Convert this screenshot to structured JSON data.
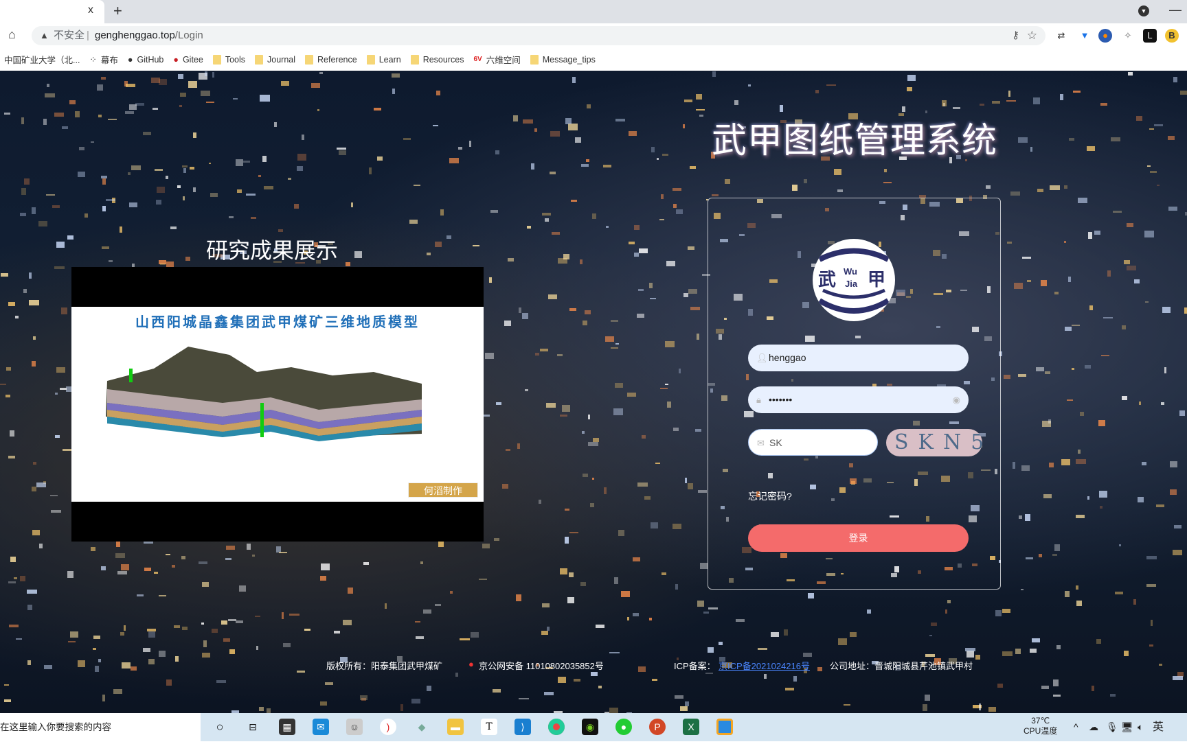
{
  "browser": {
    "tab_close": "x",
    "new_tab": "+",
    "security": "不安全",
    "url_host": "genghenggao.top",
    "url_path": "/Login",
    "bookmarks": [
      {
        "label": "中国矿业大学（北...",
        "icon": "cumt-icon"
      },
      {
        "label": "幕布",
        "icon": "mubu-icon"
      },
      {
        "label": "GitHub",
        "icon": "github-icon"
      },
      {
        "label": "Gitee",
        "icon": "gitee-icon"
      },
      {
        "label": "Tools",
        "icon": "folder-icon"
      },
      {
        "label": "Journal",
        "icon": "folder-icon"
      },
      {
        "label": "Reference",
        "icon": "folder-icon"
      },
      {
        "label": "Learn",
        "icon": "folder-icon"
      },
      {
        "label": "Resources",
        "icon": "folder-icon"
      },
      {
        "label": "六维空间",
        "icon": "6v-icon"
      },
      {
        "label": "Message_tips",
        "icon": "folder-icon"
      }
    ],
    "extensions": [
      "translate-icon",
      "vpn-icon",
      "firefox-like-icon",
      "satellite-icon",
      "l-icon",
      "b-icon"
    ]
  },
  "login": {
    "title": "武甲图纸管理系统",
    "logo_text": [
      "武",
      "Wu",
      "Jia",
      "甲"
    ],
    "username": "henggao",
    "password": "•••••••",
    "captcha_value": "SK",
    "captcha_image_text": "SKN5",
    "forgot": "忘记密码?",
    "submit": "登录"
  },
  "showcase": {
    "title": "研究成果展示",
    "video_heading": "山西阳城晶鑫集团武甲煤矿三维地质模型",
    "video_badge": "何滔制作"
  },
  "footer": {
    "copyright": "版权所有：阳泰集团武甲煤矿",
    "police": "京公网安备 11010802035852号",
    "icp_label": "ICP备案：",
    "icp_link": "京ICP备2021024216号",
    "address": "公司地址：晋城阳城县芹池镇武甲村"
  },
  "taskbar": {
    "search_placeholder": "在这里输入你要搜索的内容",
    "temp": "37℃",
    "temp_label": "CPU温度",
    "ime": "英"
  },
  "colors": {
    "login_button": "#f46b6b",
    "input_bg": "#e8f0fe",
    "link": "#4a86ff"
  }
}
